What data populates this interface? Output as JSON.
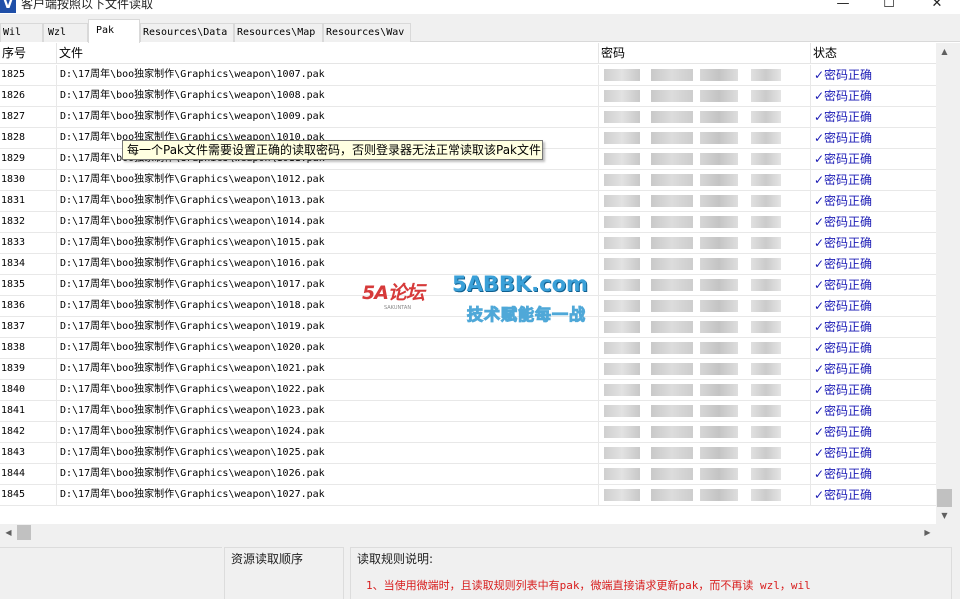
{
  "window": {
    "title": "客户端按照以下文件读取",
    "app_icon": "V",
    "min_glyph": "—",
    "max_glyph": "☐",
    "close_glyph": "✕"
  },
  "tabs": [
    {
      "label": "Wil"
    },
    {
      "label": "Wzl"
    },
    {
      "label": "Pak"
    },
    {
      "label": "Resources\\Data"
    },
    {
      "label": "Resources\\Map"
    },
    {
      "label": "Resources\\Wav"
    }
  ],
  "table": {
    "headers": {
      "seq": "序号",
      "file": "文件",
      "password": "密码",
      "status": "状态"
    },
    "rows": [
      {
        "seq": "1825",
        "file": "D:\\17周年\\boo独家制作\\Graphics\\weapon\\1007.pak",
        "status": "✓密码正确"
      },
      {
        "seq": "1826",
        "file": "D:\\17周年\\boo独家制作\\Graphics\\weapon\\1008.pak",
        "status": "✓密码正确"
      },
      {
        "seq": "1827",
        "file": "D:\\17周年\\boo独家制作\\Graphics\\weapon\\1009.pak",
        "status": "✓密码正确"
      },
      {
        "seq": "1828",
        "file": "D:\\17周年\\boo独家制作\\Graphics\\weapon\\1010.pak",
        "status": "✓密码正确"
      },
      {
        "seq": "1829",
        "file": "D:\\17周年\\boo独家制作\\Graphics\\weapon\\1011.pak",
        "status": "✓密码正确"
      },
      {
        "seq": "1830",
        "file": "D:\\17周年\\boo独家制作\\Graphics\\weapon\\1012.pak",
        "status": "✓密码正确"
      },
      {
        "seq": "1831",
        "file": "D:\\17周年\\boo独家制作\\Graphics\\weapon\\1013.pak",
        "status": "✓密码正确"
      },
      {
        "seq": "1832",
        "file": "D:\\17周年\\boo独家制作\\Graphics\\weapon\\1014.pak",
        "status": "✓密码正确"
      },
      {
        "seq": "1833",
        "file": "D:\\17周年\\boo独家制作\\Graphics\\weapon\\1015.pak",
        "status": "✓密码正确"
      },
      {
        "seq": "1834",
        "file": "D:\\17周年\\boo独家制作\\Graphics\\weapon\\1016.pak",
        "status": "✓密码正确"
      },
      {
        "seq": "1835",
        "file": "D:\\17周年\\boo独家制作\\Graphics\\weapon\\1017.pak",
        "status": "✓密码正确"
      },
      {
        "seq": "1836",
        "file": "D:\\17周年\\boo独家制作\\Graphics\\weapon\\1018.pak",
        "status": "✓密码正确"
      },
      {
        "seq": "1837",
        "file": "D:\\17周年\\boo独家制作\\Graphics\\weapon\\1019.pak",
        "status": "✓密码正确"
      },
      {
        "seq": "1838",
        "file": "D:\\17周年\\boo独家制作\\Graphics\\weapon\\1020.pak",
        "status": "✓密码正确"
      },
      {
        "seq": "1839",
        "file": "D:\\17周年\\boo独家制作\\Graphics\\weapon\\1021.pak",
        "status": "✓密码正确"
      },
      {
        "seq": "1840",
        "file": "D:\\17周年\\boo独家制作\\Graphics\\weapon\\1022.pak",
        "status": "✓密码正确"
      },
      {
        "seq": "1841",
        "file": "D:\\17周年\\boo独家制作\\Graphics\\weapon\\1023.pak",
        "status": "✓密码正确"
      },
      {
        "seq": "1842",
        "file": "D:\\17周年\\boo独家制作\\Graphics\\weapon\\1024.pak",
        "status": "✓密码正确"
      },
      {
        "seq": "1843",
        "file": "D:\\17周年\\boo独家制作\\Graphics\\weapon\\1025.pak",
        "status": "✓密码正确"
      },
      {
        "seq": "1844",
        "file": "D:\\17周年\\boo独家制作\\Graphics\\weapon\\1026.pak",
        "status": "✓密码正确"
      },
      {
        "seq": "1845",
        "file": "D:\\17周年\\boo独家制作\\Graphics\\weapon\\1027.pak",
        "status": "✓密码正确"
      }
    ]
  },
  "tooltip": {
    "text": "每一个Pak文件需要设置正确的读取密码，否则登录器无法正常读取该Pak文件"
  },
  "watermark": {
    "logo": "5A论坛",
    "logo_sub": "SAKUNTAN",
    "domain": "5ABBK.com",
    "slogan": "技术赋能每一战"
  },
  "bottom": {
    "order_label": "资源读取顺序",
    "rules_label": "读取规则说明:",
    "rules_text": "1、当使用微端时，且读取规则列表中有pak，微端直接请求更新pak，而不再读 wzl，wil"
  },
  "scrollbars": {
    "up": "▲",
    "down": "▼",
    "left": "◀",
    "right": "▶"
  },
  "colors": {
    "status": "#1b1bb5",
    "tooltip_bg": "#ffffe1",
    "rules_text": "#d81e1e",
    "icon": "#1f4fa8"
  }
}
